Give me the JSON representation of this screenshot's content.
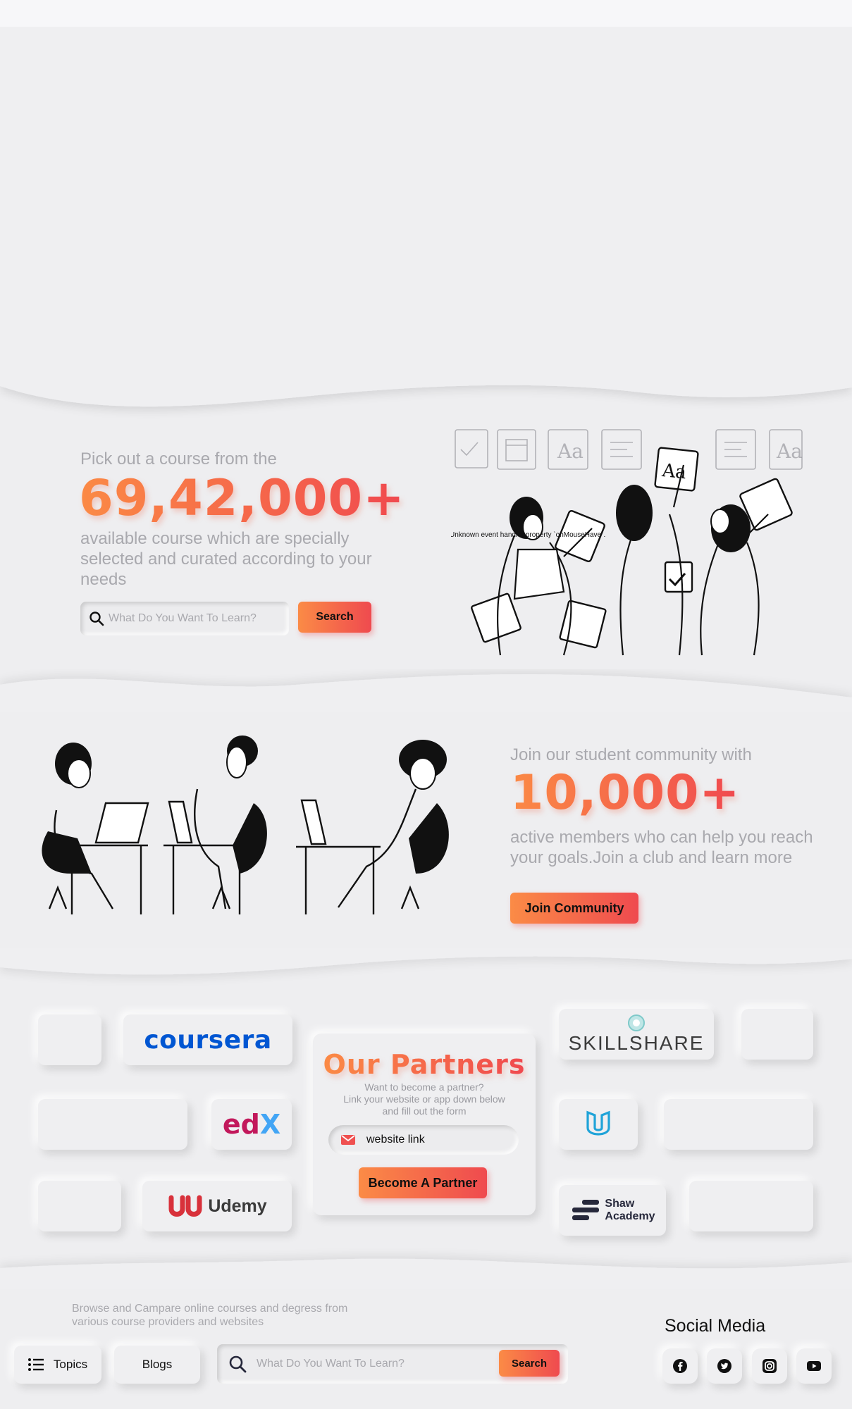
{
  "course_section": {
    "intro": "Pick out a course from the",
    "count": "69,42,000+",
    "description": "available course which are specially selected and curated according to your needs",
    "search_placeholder": "What Do You Want To Learn?",
    "search_button": "Search",
    "error_text": "Unknown event handler property `onMouseHave`."
  },
  "community_section": {
    "intro": "Join our student community with",
    "count": "10,000+",
    "description": "active members who can help you reach your goals.Join a club and learn more",
    "join_button": "Join Community"
  },
  "partners_section": {
    "title": "Our Partners",
    "subtitle_line1": "Want to become a partner?",
    "subtitle_line2": "Link your website or app down below",
    "subtitle_line3": "and fill out the form",
    "website_input_value": "website link",
    "become_partner_button": "Become A Partner",
    "logos": {
      "coursera": "coursera",
      "edx_e": "ed",
      "edx_x": "X",
      "udemy": "Udemy",
      "skillshare": "SKILLSHARE",
      "shaw_line1": "Shaw",
      "shaw_line2": "Academy"
    }
  },
  "footer": {
    "tagline_line1": "Browse and Campare online courses and degress from",
    "tagline_line2": "various course providers and websites",
    "topics_button": "Topics",
    "blogs_button": "Blogs",
    "search_placeholder": "What Do You Want To Learn?",
    "search_button": "Search",
    "social_title": "Social Media",
    "social_icons": [
      "facebook-icon",
      "twitter-icon",
      "instagram-icon",
      "youtube-icon"
    ]
  },
  "colors": {
    "accent_start": "#fb8a45",
    "accent_end": "#f0494f",
    "background": "#eeeef0",
    "muted_text": "#a9a9ae",
    "coursera_blue": "#0056d2",
    "udacity_blue": "#1fa3d8",
    "udemy_red": "#d8313b"
  }
}
